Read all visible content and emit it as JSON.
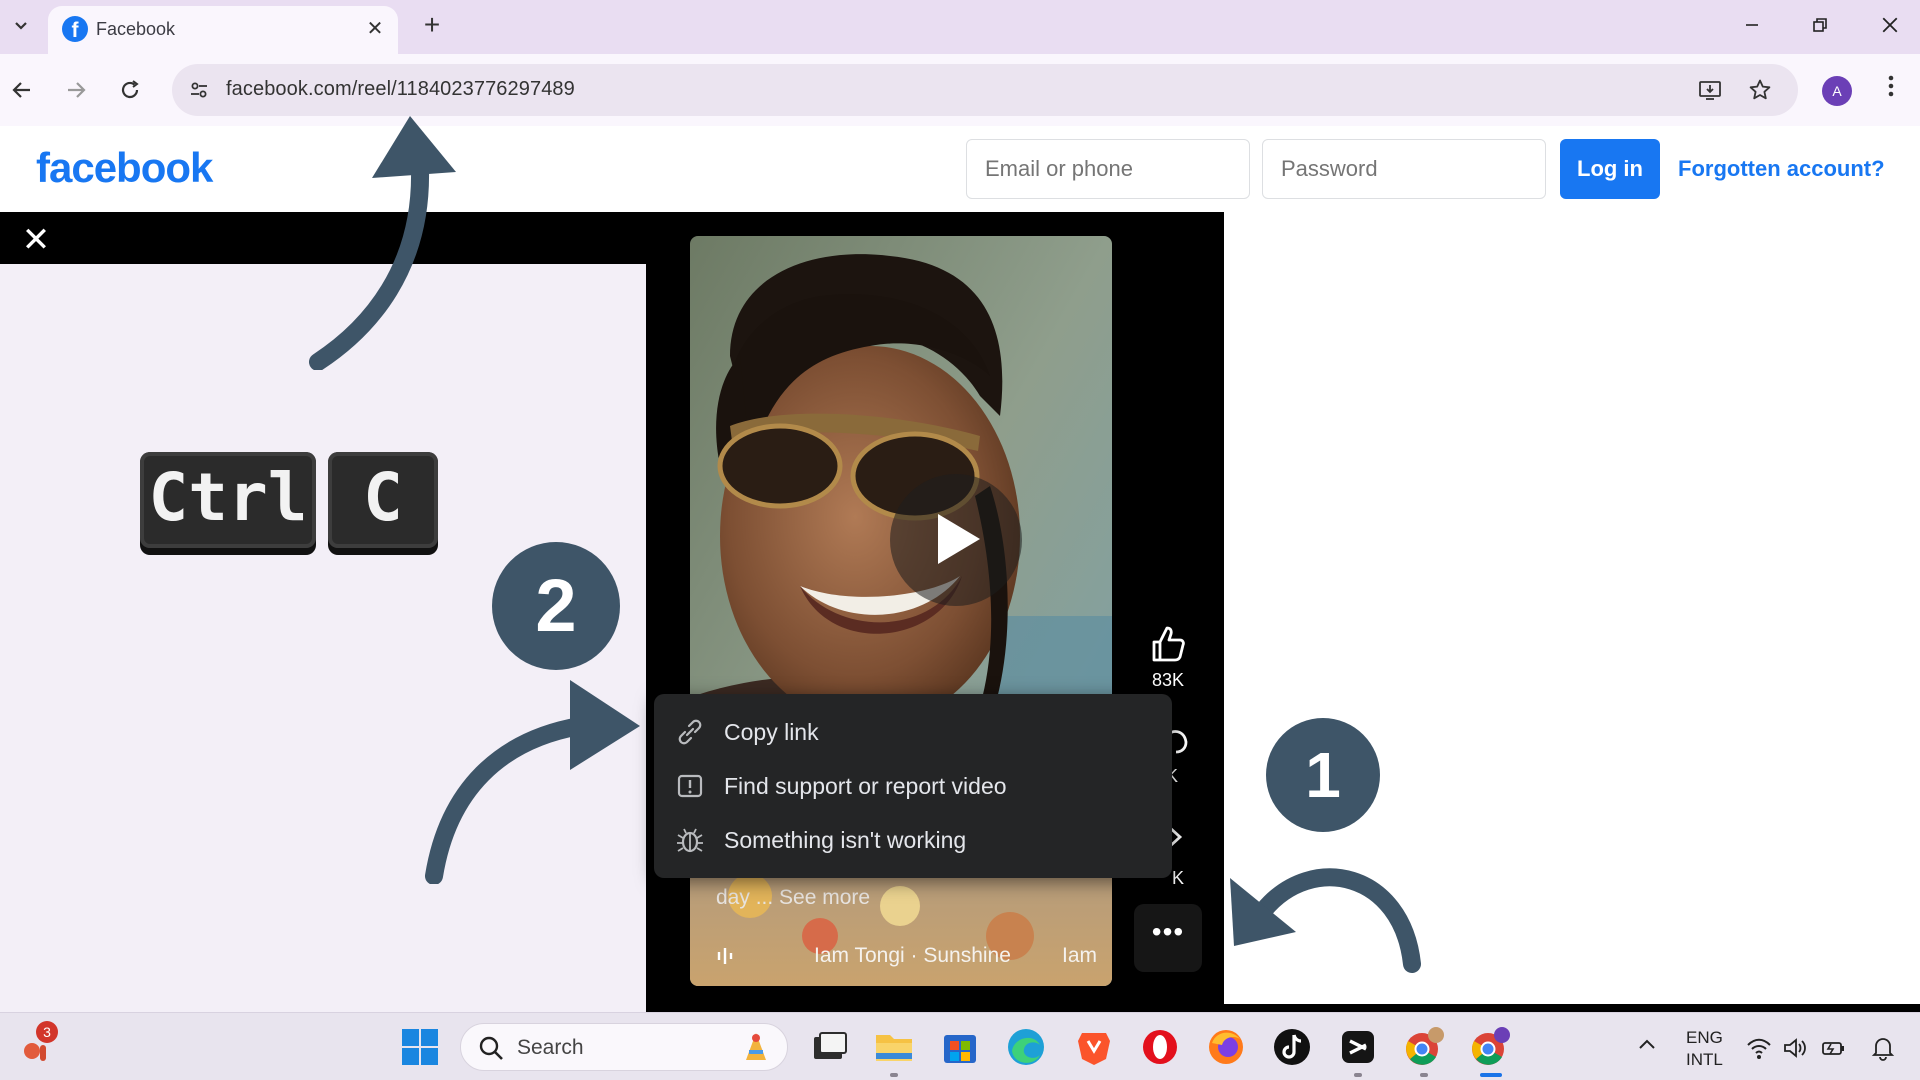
{
  "browser": {
    "tab_title": "Facebook",
    "tab_close": "✕",
    "new_tab": "+",
    "url": "facebook.com/reel/1184023776297489",
    "profile_initial": "A",
    "window_controls": {
      "minimize": "—",
      "restore": "❐",
      "close": "✕"
    }
  },
  "header": {
    "logo": "facebook",
    "email_placeholder": "Email or phone",
    "password_placeholder": "Password",
    "login_label": "Log in",
    "forgot_label": "Forgotten account?"
  },
  "viewer": {
    "close_label": "✕",
    "like_count": "83K",
    "comment_partial": "K",
    "share_partial": "K",
    "caption": "day ... See more",
    "music_track": "Iam Tongi · Sunshine",
    "music_artist": "Iam",
    "more_label": "•••"
  },
  "context_menu": {
    "items": [
      {
        "label": "Copy link",
        "icon": "link-icon"
      },
      {
        "label": "Find support or report video",
        "icon": "report-icon"
      },
      {
        "label": "Something isn't working",
        "icon": "bug-icon"
      }
    ]
  },
  "annotations": {
    "step_one": "1",
    "step_two": "2",
    "key_ctrl": "Ctrl",
    "key_c": "C"
  },
  "taskbar": {
    "weather_badge": "3",
    "search_placeholder": "Search",
    "lang_line1": "ENG",
    "lang_line2": "INTL",
    "chevron": "^"
  },
  "colors": {
    "facebook_blue": "#1877f2",
    "annotation_navy": "#3e5568",
    "menu_bg": "#242526",
    "tabbar_bg": "#e9ddf2"
  }
}
